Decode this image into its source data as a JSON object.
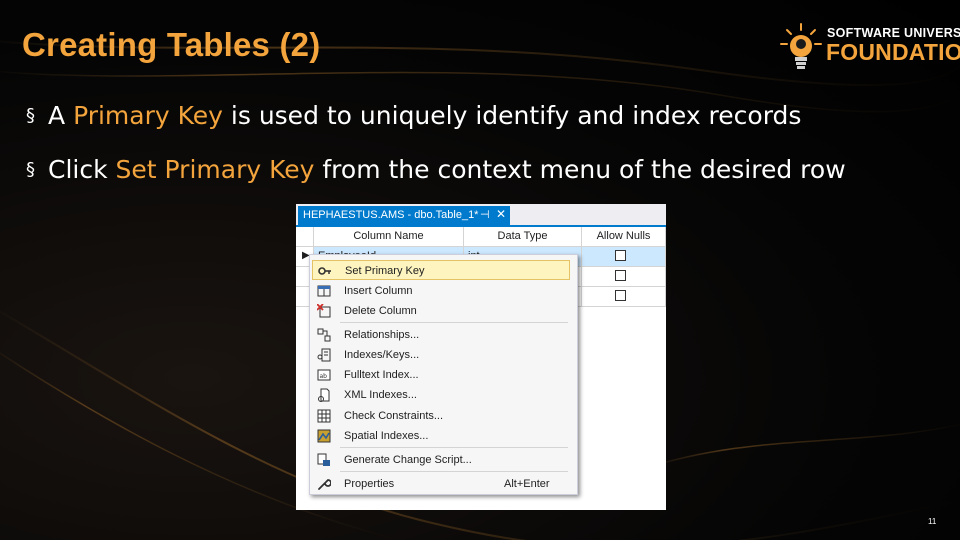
{
  "slide": {
    "title": "Creating Tables (2)",
    "logo": {
      "line1": "SOFTWARE UNIVERSITY",
      "line2": "FOUNDATION"
    },
    "bullets": [
      {
        "marker": "§",
        "pre": "A ",
        "highlight": "Primary Key",
        "post": " is used to uniquely identify and index records"
      },
      {
        "marker": "§",
        "pre": "Click ",
        "highlight": "Set Primary Key",
        "post": " from the context menu of the desired row"
      }
    ],
    "page_number": "11",
    "colors": {
      "accent": "#f3a43c",
      "background": "#000000",
      "text": "#ffffff"
    }
  },
  "ssms": {
    "tab": {
      "title": "HEPHAESTUS.AMS - dbo.Table_1*",
      "pin_icon": "pin-icon",
      "close_icon": "close-icon"
    },
    "grid": {
      "headers": [
        "Column Name",
        "Data Type",
        "Allow Nulls"
      ],
      "rows": [
        {
          "selector": "▶",
          "column_name": "EmployeeId",
          "data_type": "int",
          "allow_nulls": false
        },
        {
          "selector": "",
          "column_name": "",
          "data_type": "",
          "allow_nulls": false
        },
        {
          "selector": "",
          "column_name": "",
          "data_type": "",
          "allow_nulls": false
        }
      ]
    },
    "context_menu": {
      "items": [
        {
          "label": "Set Primary Key",
          "icon": "key-icon",
          "shortcut": ""
        },
        {
          "label": "Insert Column",
          "icon": "insert-column-icon",
          "shortcut": ""
        },
        {
          "label": "Delete Column",
          "icon": "delete-column-icon",
          "shortcut": ""
        },
        {
          "label": "Relationships...",
          "icon": "relationships-icon",
          "shortcut": ""
        },
        {
          "label": "Indexes/Keys...",
          "icon": "indexes-keys-icon",
          "shortcut": ""
        },
        {
          "label": "Fulltext Index...",
          "icon": "fulltext-index-icon",
          "shortcut": ""
        },
        {
          "label": "XML Indexes...",
          "icon": "xml-indexes-icon",
          "shortcut": ""
        },
        {
          "label": "Check Constraints...",
          "icon": "check-constraints-icon",
          "shortcut": ""
        },
        {
          "label": "Spatial Indexes...",
          "icon": "spatial-indexes-icon",
          "shortcut": ""
        },
        {
          "label": "Generate Change Script...",
          "icon": "generate-script-icon",
          "shortcut": ""
        },
        {
          "label": "Properties",
          "icon": "wrench-icon",
          "shortcut": "Alt+Enter"
        }
      ]
    }
  }
}
